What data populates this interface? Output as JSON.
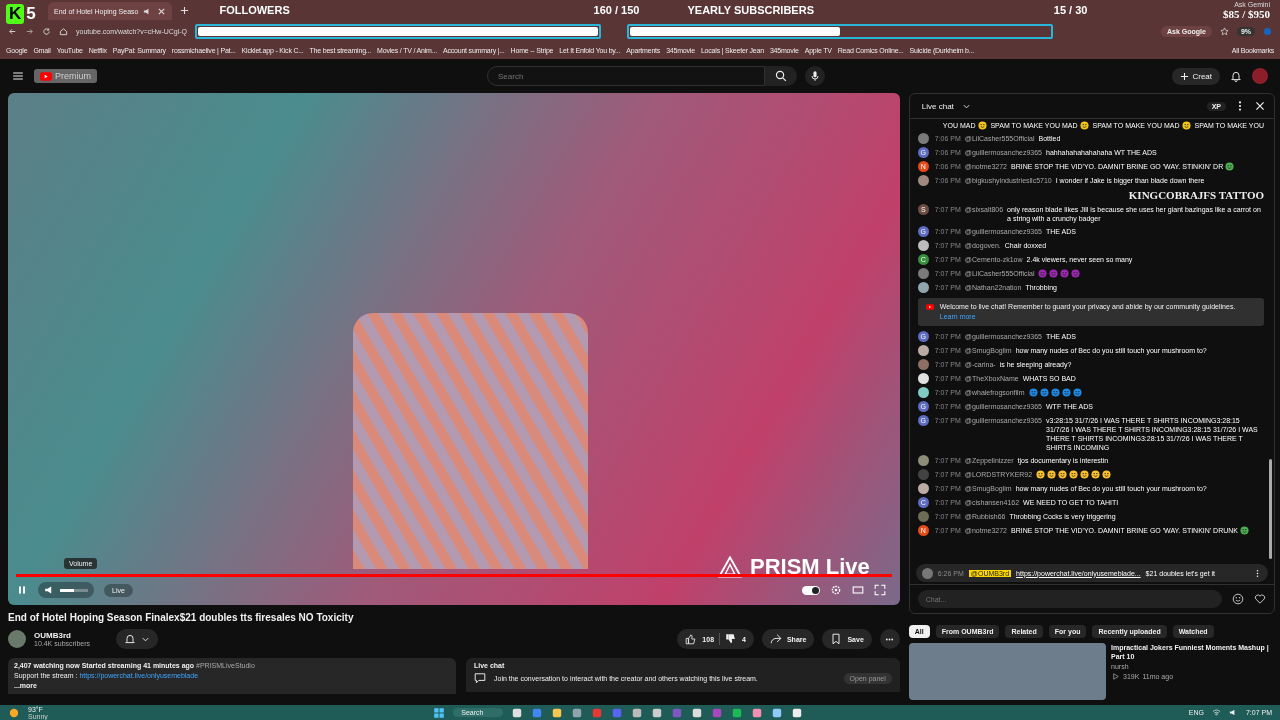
{
  "browser": {
    "tab": {
      "title": "End of Hotel Hoping Seaso"
    },
    "address": "youtube.com/watch?v=cHw-UCgl-Q",
    "ask_google": "Ask Google",
    "bookmarks": [
      "Google",
      "Gmail",
      "YouTube",
      "Netflix",
      "PayPal: Summary",
      "rossmichaelive | Pat...",
      "Kicklet.app - Kick C...",
      "The best streaming...",
      "Movies / TV / Anim...",
      "Account summary |...",
      "Home -- Stripe",
      "Let It Enfold You by...",
      "Apartments",
      "345movie",
      "Locals | Skeeter Jean",
      "345movie",
      "Apple TV",
      "Read Comics Online...",
      "Suicide (Durkheim b..."
    ],
    "all_bookmarks": "All Bookmarks"
  },
  "overlay": {
    "logo_letter": "K",
    "logo_number": "5",
    "goals": [
      {
        "label": "FOLLOWERS",
        "count": "160 / 150",
        "level": 1
      },
      {
        "label": "YEARLY SUBSCRIBERS",
        "count": "15 / 30",
        "level": 0.5
      }
    ],
    "ask_gemini": "Ask Gemini",
    "donation": "$85 / $950",
    "extension_badge": "9%",
    "tattoo": "KINGCOBRAJFS TATTOO"
  },
  "header": {
    "logo": "Premium",
    "search_placeholder": "Search",
    "create": "Creat"
  },
  "player": {
    "tooltip": "Volume",
    "live": "Live",
    "watermark": "PRISM Live",
    "volume": {
      "level": 0.5
    },
    "progress": {
      "level": 1
    },
    "autoplay_on": true
  },
  "video": {
    "title": "End of Hotel Hoping Season Finalex$21 doubles tts firesales NO Toxicity",
    "channel": "OUMB3rd",
    "subscribers": "10.4K subscribers",
    "likes": "108",
    "dislikes": "4",
    "share": "Share",
    "save": "Save"
  },
  "description": {
    "stats": "2,407 watching now  Started streaming 41 minutes ago",
    "tag": "#PRISMLiveStudio",
    "support": "Support the stream : ",
    "link": "https://powerchat.live/onlyusemeblade",
    "more": "...more"
  },
  "chat_teaser": {
    "title": "Live chat",
    "text": "Join the conversation to interact with the creator and others watching this live stream.",
    "button": "Open panel"
  },
  "chat": {
    "title": "Live chat",
    "xp": "XP",
    "top_line": [
      {
        "kind": "text",
        "text": "YOU MAD"
      },
      {
        "kind": "emoji",
        "color": "#f5c518"
      },
      {
        "kind": "text",
        "text": "SPAM TO MAKE YOU MAD"
      },
      {
        "kind": "emoji",
        "color": "#f5c518"
      },
      {
        "kind": "text",
        "text": "SPAM TO MAKE YOU MAD"
      },
      {
        "kind": "emoji",
        "color": "#f5c518"
      },
      {
        "kind": "text",
        "text": "SPAM TO MAKE YOU"
      }
    ],
    "messages": [
      {
        "kind": "message",
        "time": "7:06 PM",
        "author": "@LilCasher555Official",
        "avatar": {
          "color": "#7a7a7a"
        },
        "parts": [
          {
            "kind": "text",
            "text": "Bottled"
          }
        ]
      },
      {
        "kind": "message",
        "time": "7:06 PM",
        "author": "@guillermosanchez9365",
        "avatar": {
          "color": "#5c6bc0",
          "letter": "G"
        },
        "parts": [
          {
            "kind": "text",
            "text": "hahhahahahahahaha WT THE ADS"
          }
        ]
      },
      {
        "kind": "message",
        "time": "7:06 PM",
        "author": "@notme3272",
        "avatar": {
          "color": "#e64a19",
          "letter": "N"
        },
        "parts": [
          {
            "kind": "text",
            "text": "BRINE STOP THE VID'YO. DAMNIT BRINE GO 'WAY. STINKIN' DR"
          },
          {
            "kind": "emoji",
            "color": "#4caf50"
          }
        ]
      },
      {
        "kind": "message",
        "time": "7:06 PM",
        "author": "@bigkushyindustriesllc5710",
        "avatar": {
          "color": "#a1887f"
        },
        "parts": [
          {
            "kind": "text",
            "text": "I wonder if Jake is bigger than blade down there"
          }
        ]
      },
      {
        "kind": "message",
        "time": "7:07 PM",
        "author": "@sixsalt806",
        "avatar": {
          "color": "#6d4c41",
          "letter": "S"
        },
        "parts": [
          {
            "kind": "text",
            "text": "only reason blade likes Jill is because she uses her giant bazingas like a carrot on a string with a crunchy badger"
          }
        ]
      },
      {
        "kind": "message",
        "time": "7:07 PM",
        "author": "@guillermosanchez9365",
        "avatar": {
          "color": "#5c6bc0",
          "letter": "G"
        },
        "parts": [
          {
            "kind": "text",
            "text": "THE ADS"
          }
        ]
      },
      {
        "kind": "message",
        "time": "7:07 PM",
        "author": "@dogoven.",
        "avatar": {
          "color": "#bdbdbd"
        },
        "parts": [
          {
            "kind": "text",
            "text": "Chair doxxed"
          }
        ]
      },
      {
        "kind": "message",
        "time": "7:07 PM",
        "author": "@Cemento-zk1ow",
        "avatar": {
          "color": "#388e3c",
          "letter": "C"
        },
        "parts": [
          {
            "kind": "text",
            "text": "2.4k viewers, never seen so many"
          }
        ]
      },
      {
        "kind": "message",
        "time": "7:07 PM",
        "author": "@LilCasher555Official",
        "avatar": {
          "color": "#7a7a7a"
        },
        "parts": [
          {
            "kind": "emoji",
            "color": "#9c27b0"
          },
          {
            "kind": "emoji",
            "color": "#9c27b0"
          },
          {
            "kind": "emoji",
            "color": "#9c27b0"
          },
          {
            "kind": "emoji",
            "color": "#9c27b0"
          }
        ]
      },
      {
        "kind": "message",
        "time": "7:07 PM",
        "author": "@Nathan22nation",
        "avatar": {
          "color": "#90a4ae"
        },
        "parts": [
          {
            "kind": "text",
            "text": "Throbbing"
          }
        ]
      },
      {
        "kind": "notice",
        "text": "Welcome to live chat! Remember to guard your privacy and abide by our community guidelines.",
        "link": "Learn more"
      },
      {
        "kind": "message",
        "time": "7:07 PM",
        "author": "@guillermosanchez9365",
        "avatar": {
          "color": "#5c6bc0",
          "letter": "G"
        },
        "parts": [
          {
            "kind": "text",
            "text": "THE ADS"
          }
        ]
      },
      {
        "kind": "message",
        "time": "7:07 PM",
        "author": "@SmugBoglim",
        "avatar": {
          "color": "#bcaaa4"
        },
        "parts": [
          {
            "kind": "text",
            "text": "how many nudes of Bec do you still touch your mushroom to?"
          }
        ]
      },
      {
        "kind": "message",
        "time": "7:07 PM",
        "author": "@-carina-",
        "avatar": {
          "color": "#8d6e63"
        },
        "parts": [
          {
            "kind": "text",
            "text": "is he sleeping already?"
          }
        ]
      },
      {
        "kind": "message",
        "time": "7:07 PM",
        "author": "@TheXboxName",
        "avatar": {
          "color": "#e0e0e0"
        },
        "parts": [
          {
            "kind": "text",
            "text": "WHATS SO BAD"
          }
        ]
      },
      {
        "kind": "message",
        "time": "7:07 PM",
        "author": "@whalefrogsonfilm",
        "avatar": {
          "color": "#80cbc4"
        },
        "parts": [
          {
            "kind": "emoji",
            "color": "#1e88e5"
          },
          {
            "kind": "emoji",
            "color": "#1e88e5"
          },
          {
            "kind": "emoji",
            "color": "#1e88e5"
          },
          {
            "kind": "emoji",
            "color": "#1e88e5"
          },
          {
            "kind": "emoji",
            "color": "#1e88e5"
          }
        ]
      },
      {
        "kind": "message",
        "time": "7:07 PM",
        "author": "@guillermosanchez9365",
        "avatar": {
          "color": "#5c6bc0",
          "letter": "G"
        },
        "parts": [
          {
            "kind": "text",
            "text": "WTF THE ADS"
          }
        ]
      },
      {
        "kind": "message",
        "time": "7:07 PM",
        "author": "@guillermosanchez9365",
        "avatar": {
          "color": "#5c6bc0",
          "letter": "G"
        },
        "parts": [
          {
            "kind": "text",
            "text": "v3:28:15 31/7/26 I WAS THERE T SHIRTS INCOMING3:28:15 31/7/26 I WAS THERE T SHIRTS INCOMING3:28:15 31/7/26 I WAS THERE T SHIRTS INCOMING3:28:15 31/7/26 I WAS THERE T SHIRTS INCOMING"
          }
        ]
      },
      {
        "kind": "message",
        "time": "7:07 PM",
        "author": "@Zeppelinizzer",
        "avatar": {
          "color": "#8d8d7a"
        },
        "parts": [
          {
            "kind": "text",
            "text": "tjos documentary is interestin"
          }
        ]
      },
      {
        "kind": "message",
        "time": "7:07 PM",
        "author": "@LORDSTRYKER92",
        "avatar": {
          "color": "#424242"
        },
        "parts": [
          {
            "kind": "emoji",
            "color": "#fbc02d"
          },
          {
            "kind": "emoji",
            "color": "#fbc02d"
          },
          {
            "kind": "emoji",
            "color": "#fbc02d"
          },
          {
            "kind": "emoji",
            "color": "#fbc02d"
          },
          {
            "kind": "emoji",
            "color": "#fbc02d"
          },
          {
            "kind": "emoji",
            "color": "#fbc02d"
          },
          {
            "kind": "emoji",
            "color": "#fbc02d"
          }
        ]
      },
      {
        "kind": "message",
        "time": "7:07 PM",
        "author": "@SmugBoglim",
        "avatar": {
          "color": "#bcaaa4"
        },
        "parts": [
          {
            "kind": "text",
            "text": "how many nudes of Bec do you still touch your mushroom to?"
          }
        ]
      },
      {
        "kind": "message",
        "time": "7:07 PM",
        "author": "@cishansen4162",
        "avatar": {
          "color": "#5c6bc0",
          "letter": "C"
        },
        "parts": [
          {
            "kind": "text",
            "text": "WE NEED TO GET TO TAHITI"
          }
        ]
      },
      {
        "kind": "message",
        "time": "7:07 PM",
        "author": "@Rubbish66",
        "avatar": {
          "color": "#6d6a55"
        },
        "parts": [
          {
            "kind": "text",
            "text": "Throbbing Cocks is very triggering"
          }
        ]
      },
      {
        "kind": "message",
        "time": "7:07 PM",
        "author": "@notme3272",
        "avatar": {
          "color": "#e64a19",
          "letter": "N"
        },
        "parts": [
          {
            "kind": "text",
            "text": "BRINE STOP THE VID'YO. DAMNIT BRINE GO 'WAY. STINKIN' DRUNK"
          },
          {
            "kind": "emoji",
            "color": "#4caf50"
          }
        ]
      }
    ],
    "pinned": {
      "time": "6:26 PM",
      "author": "@OUMB3rd",
      "link": "https://powerchat.live/onlyusemeblade...",
      "text": "$21 doubles let's get it"
    },
    "input_placeholder": "Chat..."
  },
  "chips": [
    {
      "label": "All",
      "selected": true
    },
    {
      "label": "From OUMB3rd",
      "selected": false
    },
    {
      "label": "Related",
      "selected": false
    },
    {
      "label": "For you",
      "selected": false
    },
    {
      "label": "Recently uploaded",
      "selected": false
    },
    {
      "label": "Watched",
      "selected": false
    }
  ],
  "recommendation": {
    "title": "Impractical Jokers Funniest Moments Mashup | Part 10",
    "channel": "nursh",
    "views": "319K",
    "age": "11mo ago"
  },
  "taskbar": {
    "temperature": "93°F",
    "weather": "Sunny",
    "search": "Search",
    "language": "ENG",
    "time": "7:07 PM"
  }
}
